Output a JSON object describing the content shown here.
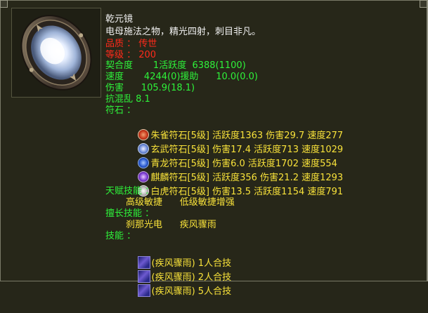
{
  "item": {
    "name": "乾元镜",
    "description": "电母施法之物，精光四射，刺目非凡。",
    "quality": "品质 ： 传世",
    "level": "等级 ： 200",
    "fit": "契合度       1活跃度  6388(1100)",
    "speed": "速度       4244(0)援助      10.0(0.0)",
    "damage": "伤害      105.9(18.1)",
    "anti_chaos": "抗混乱 8.1",
    "runes_label": "符石 ：",
    "runes": [
      {
        "icon": "zhuque-rune-icon",
        "text": "朱雀符石[5级] 活跃度1363 伤害29.7 速度277",
        "color": "#d84a2a"
      },
      {
        "icon": "xuanwu-rune-icon",
        "text": "玄武符石[5级] 伤害17.4 活跃度713 速度1029",
        "color": "#5a8ad8"
      },
      {
        "icon": "qinglong-rune-icon",
        "text": "青龙符石[5级] 伤害6.0 活跃度1702 速度554",
        "color": "#3a6ad0"
      },
      {
        "icon": "qilin-rune-icon",
        "text": "麒麟符石[5级] 活跃度356 伤害21.2 速度1293",
        "color": "#8a4ad8"
      },
      {
        "icon": "baihu-rune-icon",
        "text": "白虎符石[5级] 伤害13.5 活跃度1154 速度791",
        "color": "#c8c8c8"
      }
    ],
    "talent_label": "天赋技能 ：",
    "talent_skills": "高级敏捷      低级敏捷增强",
    "specialty_label": "擅长技能 ：",
    "specialty_skills": "刹那光电      疾风骤雨",
    "skills_label": "技能 ：",
    "skills": [
      "(疾风骤雨) 1人合技",
      "(疾风骤雨) 2人合技",
      "(疾风骤雨) 5人合技"
    ]
  }
}
